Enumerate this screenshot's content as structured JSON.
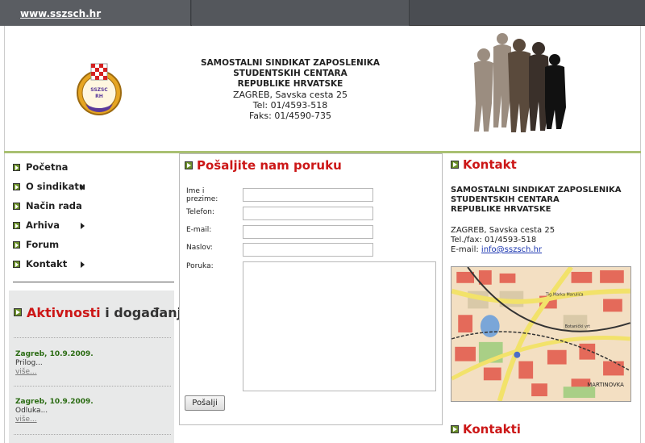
{
  "topbar": {
    "site_link": "www.sszsch.hr"
  },
  "header": {
    "org_line1": "SAMOSTALNI SINDIKAT ZAPOSLENIKA",
    "org_line2": "STUDENTSKIH CENTARA",
    "org_line3": "REPUBLIKE HRVATSKE",
    "address": "ZAGREB, Savska cesta 25",
    "phone": "Tel: 01/4593-518",
    "fax": "Faks: 01/4590-735",
    "logo_text1": "SSZSC",
    "logo_text2": "RH"
  },
  "nav": {
    "items": [
      {
        "label": "Početna",
        "submenu": false
      },
      {
        "label": "O sindikatu",
        "submenu": true
      },
      {
        "label": "Način rada",
        "submenu": false
      },
      {
        "label": "Arhiva",
        "submenu": true
      },
      {
        "label": "Forum",
        "submenu": false
      },
      {
        "label": "Kontakt",
        "submenu": true
      }
    ]
  },
  "events": {
    "title_red": "Aktivnosti",
    "title_rest": " i događanja",
    "items": [
      {
        "date": "Zagreb, 10.9.2009.",
        "text": "Prilog...",
        "more": "više..."
      },
      {
        "date": "Zagreb, 10.9.2009.",
        "text": "Odluka...",
        "more": "više..."
      }
    ]
  },
  "form": {
    "title": "Pošaljite nam poruku",
    "label_name": "Ime i prezime:",
    "label_phone": "Telefon:",
    "label_email": "E-mail:",
    "label_subject": "Naslov:",
    "label_message": "Poruka:",
    "submit_label": "Pošalji"
  },
  "contact": {
    "title": "Kontakt",
    "org_line1": "SAMOSTALNI SINDIKAT ZAPOSLENIKA",
    "org_line2": "STUDENTSKIH CENTARA",
    "org_line3": "REPUBLIKE HRVATSKE",
    "address": "ZAGREB, Savska cesta 25",
    "phone": "Tel./fax: 01/4593-518",
    "email_label": "E-mail:",
    "email": "info@sszsch.hr",
    "map_label1": "Tig.Marka Marulića",
    "map_label2": "Botanički vrt",
    "map_label3": "MARTINOVKA",
    "contacts_title": "Kontakti"
  },
  "colors": {
    "accent_red": "#cc1717",
    "bullet_green": "#6a8f2a",
    "header_line": "#a9c072"
  }
}
